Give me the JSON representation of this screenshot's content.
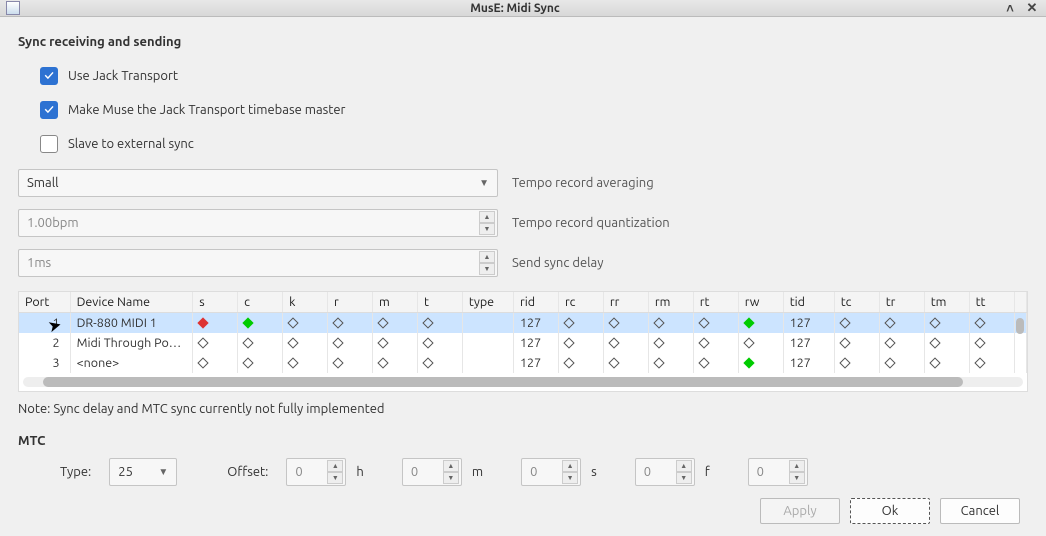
{
  "window": {
    "title": "MusE: Midi Sync"
  },
  "section1": {
    "title": "Sync receiving and sending",
    "chk_jack": "Use Jack Transport",
    "chk_timebase": "Make Muse the Jack Transport timebase master",
    "chk_slave": "Slave to external sync"
  },
  "averaging": {
    "value": "Small",
    "label": "Tempo record averaging"
  },
  "quant": {
    "value": "1.00bpm",
    "label": "Tempo record quantization"
  },
  "delay": {
    "value": "1ms",
    "label": "Send sync delay"
  },
  "table": {
    "headers": {
      "port": "Port",
      "device": "Device Name",
      "s": "s",
      "c": "c",
      "k": "k",
      "r": "r",
      "m": "m",
      "t": "t",
      "type": "type",
      "rid": "rid",
      "rc": "rc",
      "rr": "rr",
      "rm": "rm",
      "rt": "rt",
      "rw": "rw",
      "tid": "tid",
      "tc": "tc",
      "tr": "tr",
      "tm": "tm",
      "tt": "tt"
    },
    "rows": [
      {
        "port": "1",
        "device": "DR-880 MIDI 1",
        "s": "red",
        "c": "green",
        "rid": "127",
        "rw": "green",
        "tid": "127"
      },
      {
        "port": "2",
        "device": "Midi Through Po…",
        "s": "empty",
        "c": "empty",
        "rid": "127",
        "rw": "empty",
        "tid": "127"
      },
      {
        "port": "3",
        "device": "<none>",
        "s": "empty",
        "c": "empty",
        "rid": "127",
        "rw": "green",
        "tid": "127"
      }
    ]
  },
  "note": "Note: Sync delay and MTC sync currently not fully implemented",
  "mtc": {
    "title": "MTC",
    "type_label": "Type:",
    "type_value": "25",
    "offset_label": "Offset:",
    "h": "0",
    "h_unit": "h",
    "m": "0",
    "m_unit": "m",
    "s": "0",
    "s_unit": "s",
    "f": "0",
    "f_unit": "f",
    "sf": "0"
  },
  "buttons": {
    "apply": "Apply",
    "ok": "Ok",
    "cancel": "Cancel"
  }
}
